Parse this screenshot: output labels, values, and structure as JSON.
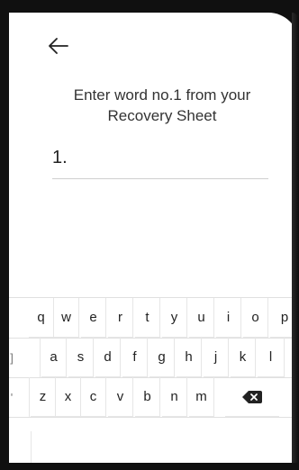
{
  "prompt": {
    "line1": "Enter word no.1 from your",
    "line2": "Recovery Sheet"
  },
  "word_field": {
    "prefix": "1.",
    "value": ""
  },
  "keyboard": {
    "row1": [
      "q",
      "w",
      "e",
      "r",
      "t",
      "y",
      "u",
      "i",
      "o",
      "p"
    ],
    "row2": [
      "a",
      "s",
      "d",
      "f",
      "g",
      "h",
      "j",
      "k",
      "l"
    ],
    "row3": [
      "z",
      "x",
      "c",
      "v",
      "b",
      "n",
      "m"
    ],
    "partial_left": [
      "]",
      "'"
    ]
  },
  "icons": {
    "back": "arrow-left-icon",
    "backspace": "backspace-icon"
  }
}
